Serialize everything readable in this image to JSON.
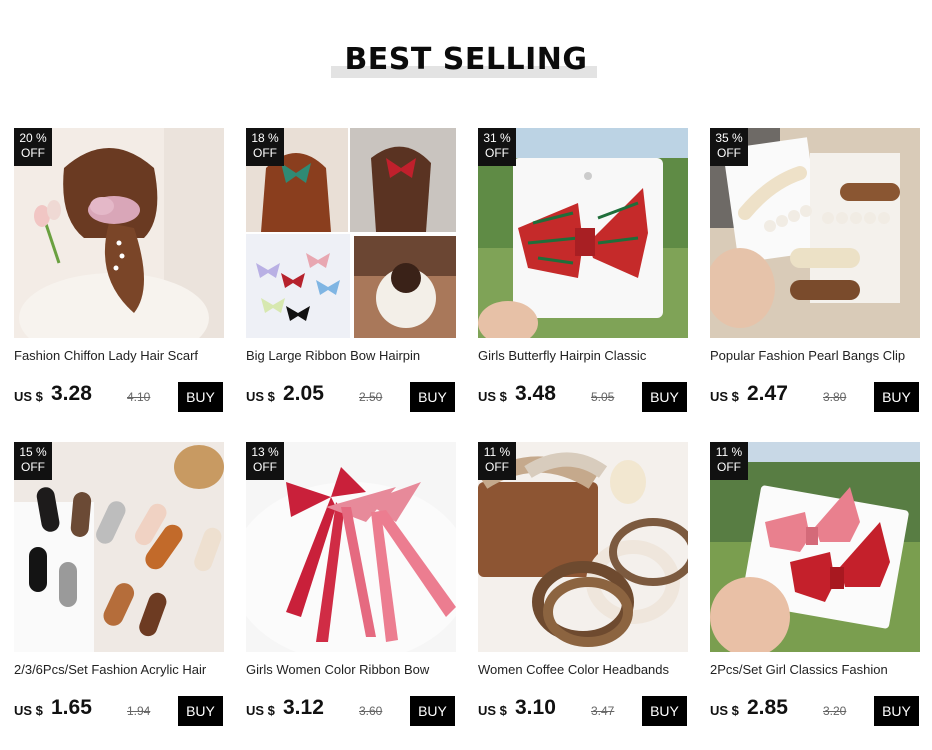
{
  "section": {
    "title": "BEST SELLING"
  },
  "currency": "US $",
  "buy_label": "BUY",
  "products": [
    {
      "name": "Fashion Chiffon Lady Hair Scarf",
      "discount": "20 %",
      "off": "OFF",
      "price": "3.28",
      "old_price": "4.10"
    },
    {
      "name": "Big Large Ribbon Bow Hairpin",
      "discount": "18 %",
      "off": "OFF",
      "price": "2.05",
      "old_price": "2.50"
    },
    {
      "name": "Girls Butterfly Hairpin Classic",
      "discount": "31 %",
      "off": "OFF",
      "price": "3.48",
      "old_price": "5.05"
    },
    {
      "name": "Popular Fashion Pearl Bangs Clip",
      "discount": "35 %",
      "off": "OFF",
      "price": "2.47",
      "old_price": "3.80"
    },
    {
      "name": "2/3/6Pcs/Set Fashion Acrylic Hair",
      "discount": "15 %",
      "off": "OFF",
      "price": "1.65",
      "old_price": "1.94"
    },
    {
      "name": "Girls Women Color Ribbon Bow",
      "discount": "13 %",
      "off": "OFF",
      "price": "3.12",
      "old_price": "3.60"
    },
    {
      "name": "Women Coffee Color Headbands",
      "discount": "11 %",
      "off": "OFF",
      "price": "3.10",
      "old_price": "3.47"
    },
    {
      "name": "2Pcs/Set Girl Classics Fashion",
      "discount": "11 %",
      "off": "OFF",
      "price": "2.85",
      "old_price": "3.20"
    }
  ]
}
